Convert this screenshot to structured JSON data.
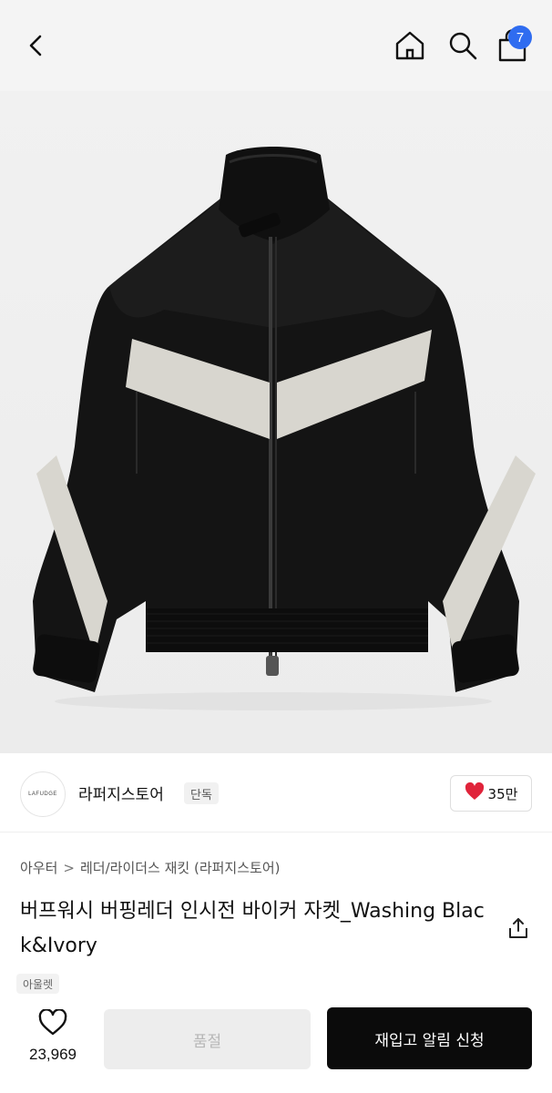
{
  "header": {
    "back_icon": "chevron-left-icon",
    "home_icon": "home-icon",
    "search_icon": "search-icon",
    "cart_icon": "shopping-bag-icon",
    "cart_count": "7",
    "accent_color": "#2f6cf0"
  },
  "product_image": {
    "subject": "black leather bomber jacket with ivory chevron stripe"
  },
  "store": {
    "logo_text": "LAFUDGE",
    "name": "라퍼지스토어",
    "tag": "단독",
    "like_icon": "heart-filled-icon",
    "like_count": "35만",
    "like_color": "#e0233a"
  },
  "breadcrumb": {
    "level1": "아우터",
    "separator": ">",
    "level2": "레더/라이더스 재킷 (라퍼지스토어)"
  },
  "product": {
    "title": "버프워시 버핑레더 인시전 바이커 자켓_Washing Black&Ivory",
    "share_icon": "share-icon",
    "seller_tag": "아울렛"
  },
  "bottom_bar": {
    "wish_icon": "heart-outline-icon",
    "wish_count": "23,969",
    "soldout_label": "품절",
    "restock_label": "재입고 알림 신청"
  }
}
